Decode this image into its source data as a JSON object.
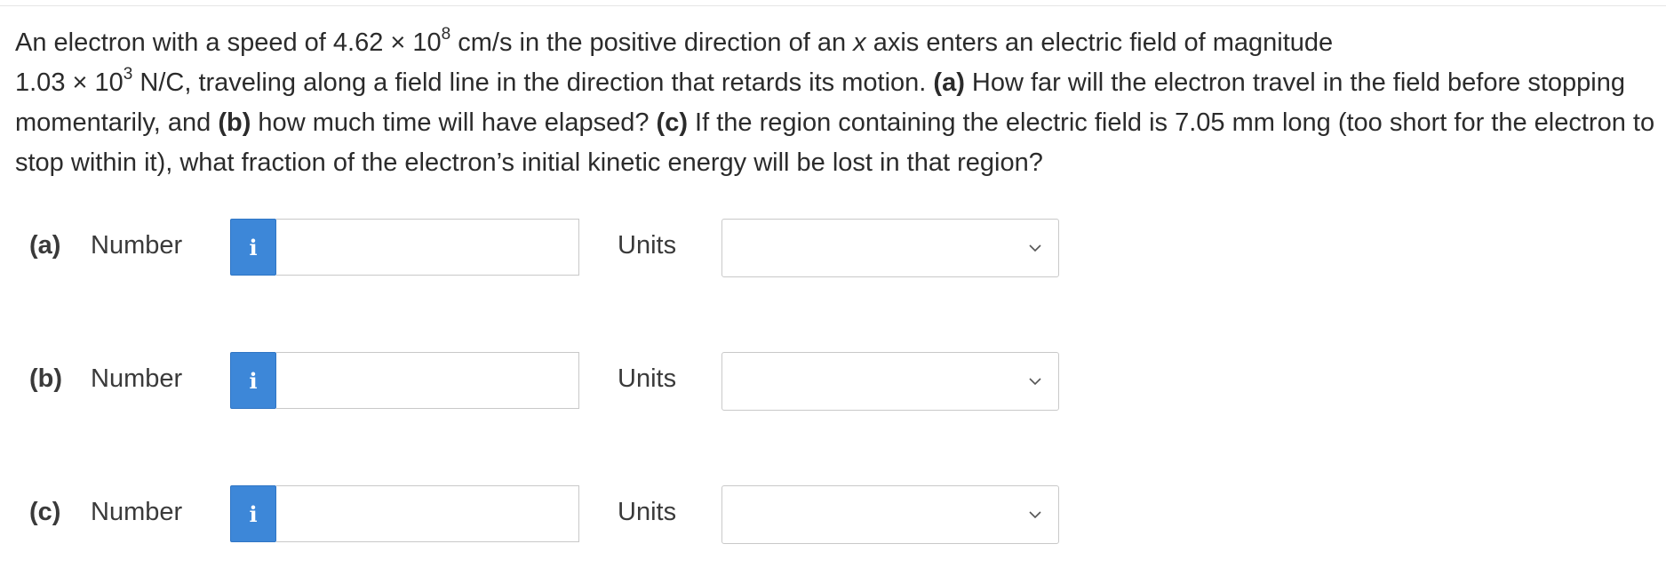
{
  "question": {
    "p1": "An electron with a speed of 4.62 × 10",
    "exp1": "8",
    "p2": " cm/s in the positive direction of an ",
    "var_x": "x",
    "p3": " axis enters an electric field of magnitude",
    "p4": "1.03 × 10",
    "exp2": "3",
    "p5": " N/C, traveling along a field line in the direction that retards its motion. ",
    "a_marker": "(a)",
    "p6": " How far will the electron travel in the field before stopping momentarily, and ",
    "b_marker": "(b)",
    "p7": " how much time will have elapsed? ",
    "c_marker": "(c)",
    "p8": " If the region containing the electric field is 7.05 mm long (too short for the electron to stop within it), what fraction of the electron’s initial kinetic energy will be lost in that region?"
  },
  "parts": [
    {
      "label": "(a)",
      "number_label": "Number",
      "info_icon": "i",
      "number_value": "",
      "units_label": "Units",
      "units_value": ""
    },
    {
      "label": "(b)",
      "number_label": "Number",
      "info_icon": "i",
      "number_value": "",
      "units_label": "Units",
      "units_value": ""
    },
    {
      "label": "(c)",
      "number_label": "Number",
      "info_icon": "i",
      "number_value": "",
      "units_label": "Units",
      "units_value": ""
    }
  ],
  "colors": {
    "info_button": "#3d87d8",
    "text": "#2b2b2b",
    "border": "#c9c9c9"
  },
  "icons": {
    "info": "info-icon",
    "dropdown": "chevron-down-icon"
  }
}
